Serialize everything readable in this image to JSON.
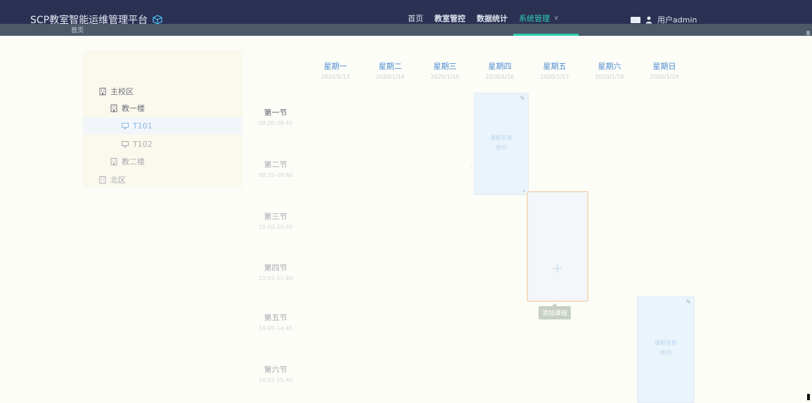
{
  "header": {
    "brand_title": "SCP教室智能运维管理平台",
    "brand_sub": "首页",
    "nav": [
      {
        "label": "首页"
      },
      {
        "label": "教室管控"
      },
      {
        "label": "数据统计"
      },
      {
        "label": "系统管理"
      }
    ],
    "user_label": "用户admin",
    "colors": {
      "header_bg": "#2b3153",
      "accent": "#2fd0b0"
    }
  },
  "tree": {
    "campuses": [
      {
        "label": "主校区"
      },
      {
        "label": "北区"
      }
    ],
    "buildings": [
      {
        "label": "教一楼"
      },
      {
        "label": "教二楼"
      }
    ],
    "rooms": [
      {
        "label": "T101"
      },
      {
        "label": "T102"
      }
    ]
  },
  "schedule": {
    "days": [
      {
        "name": "星期一"
      },
      {
        "name": "星期二"
      },
      {
        "name": "星期三"
      },
      {
        "name": "星期四"
      },
      {
        "name": "星期五"
      },
      {
        "name": "星期六"
      },
      {
        "name": "星期日"
      }
    ],
    "periods": [
      {
        "name": "第一节"
      },
      {
        "name": "第二节"
      },
      {
        "name": "第三节"
      },
      {
        "name": "第四节"
      },
      {
        "name": "第五节"
      },
      {
        "name": "第六节"
      }
    ],
    "lessons": [
      {
        "day": "星期四",
        "periods": "第一节–第二节"
      },
      {
        "day": "星期日",
        "periods": "第五节–第六节"
      }
    ],
    "add_slot": {
      "day": "星期五",
      "periods": "第三节–第四节",
      "plus": "+"
    },
    "tooltip": "添加课程"
  }
}
